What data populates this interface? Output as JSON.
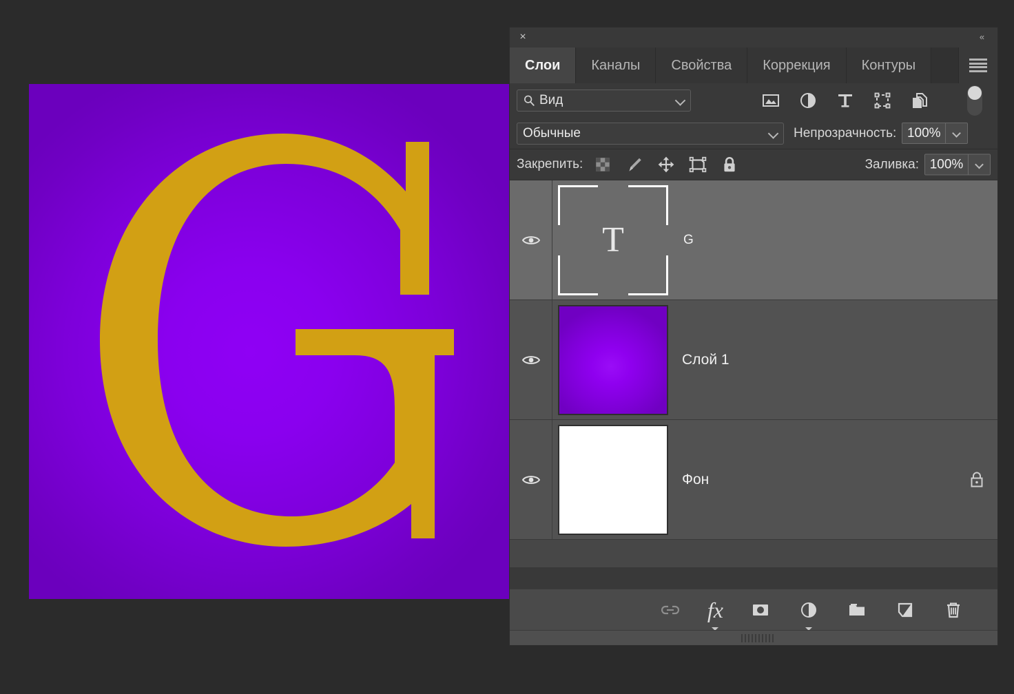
{
  "canvas": {
    "name": "document-canvas",
    "letter": "G",
    "letter_color": "#d2a014",
    "bg_center_color": "#8f00f5",
    "bg_edge_color": "#6b00bd",
    "workspace_color": "#2b2b2b"
  },
  "panel": {
    "close_label": "×",
    "collapse_label": "«",
    "menu_icon": "hamburger-menu-icon",
    "tabs": [
      {
        "label": "Слои",
        "active": true
      },
      {
        "label": "Каналы",
        "active": false
      },
      {
        "label": "Свойства",
        "active": false
      },
      {
        "label": "Коррекция",
        "active": false
      },
      {
        "label": "Контуры",
        "active": false
      }
    ]
  },
  "filter": {
    "search_icon": "magnifier-icon",
    "value": "Вид",
    "dropdown_icon": "chevron-down-icon",
    "type_icons": [
      "image-filter-icon",
      "adjustment-filter-icon",
      "text-filter-icon",
      "shape-filter-icon",
      "smart-object-filter-icon"
    ],
    "toggle_icon": "filter-enable-toggle"
  },
  "blend": {
    "mode": "Обычные",
    "opacity_label": "Непрозрачность:",
    "opacity_value": "100%"
  },
  "lock": {
    "label": "Закрепить:",
    "icons": [
      "lock-transparent-pixels-icon",
      "lock-image-pixels-icon",
      "lock-position-icon",
      "lock-artboard-nesting-icon",
      "lock-all-icon"
    ],
    "fill_label": "Заливка:",
    "fill_value": "100%"
  },
  "layers": [
    {
      "name": "G",
      "kind": "text",
      "visible": true,
      "selected": true,
      "thumb_glyph": "T",
      "locked": false,
      "eye_icon": "eye-icon"
    },
    {
      "name": "Слой 1",
      "kind": "raster-gradient",
      "visible": true,
      "selected": false,
      "locked": false,
      "eye_icon": "eye-icon"
    },
    {
      "name": "Фон",
      "kind": "background",
      "visible": true,
      "selected": false,
      "locked": true,
      "lock_icon": "lock-icon",
      "eye_icon": "eye-icon"
    }
  ],
  "bottom_toolbar": [
    {
      "icon": "link-layers-icon",
      "label": ""
    },
    {
      "icon": "layer-effects-fx-icon",
      "label": "fx"
    },
    {
      "icon": "add-layer-mask-icon",
      "label": ""
    },
    {
      "icon": "new-adjustment-layer-icon",
      "label": ""
    },
    {
      "icon": "new-group-folder-icon",
      "label": ""
    },
    {
      "icon": "new-layer-icon",
      "label": ""
    },
    {
      "icon": "delete-layer-trash-icon",
      "label": ""
    }
  ],
  "scrollbar": {
    "grip_icon": "resize-grip-icon"
  }
}
